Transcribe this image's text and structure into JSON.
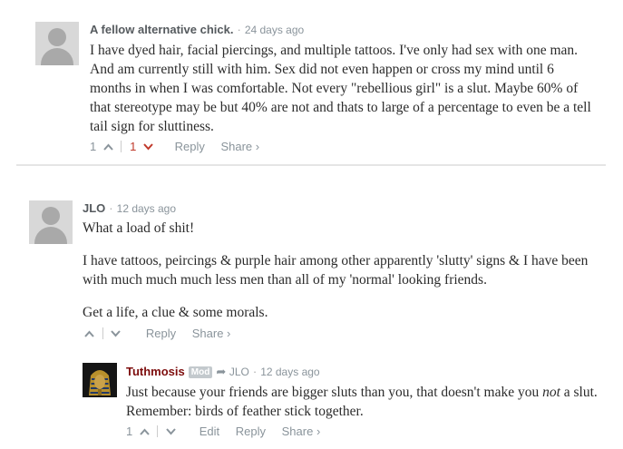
{
  "comments": [
    {
      "author": "A fellow alternative chick.",
      "time": "24 days ago",
      "body": [
        "I have dyed hair, facial piercings, and multiple tattoos. I've only had sex with one man. And am currently still with him. Sex did not even happen or cross my mind until 6 months in when I was comfortable. Not every \"rebellious girl\" is a slut. Maybe 60% of that stereotype may be but 40% are not and thats to large of a percentage to even be a tell tail sign for sluttiness."
      ],
      "upvotes": "1",
      "downvotes": "1",
      "reply": "Reply",
      "share": "Share ›"
    },
    {
      "author": "JLO",
      "time": "12 days ago",
      "body": [
        "What a load of shit!",
        "I have tattoos, peircings & purple hair among other apparently 'slutty' signs & I have been with much much much less men than all of my 'normal' looking friends.",
        "Get a life, a clue & some morals."
      ],
      "reply": "Reply",
      "share": "Share ›"
    },
    {
      "author": "Tuthmosis",
      "badge": "Mod",
      "in_reply_to": "JLO",
      "time": "12 days ago",
      "body_pre": "Just because your friends are bigger sluts than you, that doesn't make you ",
      "body_em": "not",
      "body_post": " a slut. Remember: birds of feather stick together.",
      "upvotes": "1",
      "edit": "Edit",
      "reply": "Reply",
      "share": "Share ›"
    }
  ],
  "separator": "·",
  "colors": {
    "mod_author": "#7d0d0d",
    "downvote_active": "#c0392b",
    "meta": "#8a949b"
  }
}
